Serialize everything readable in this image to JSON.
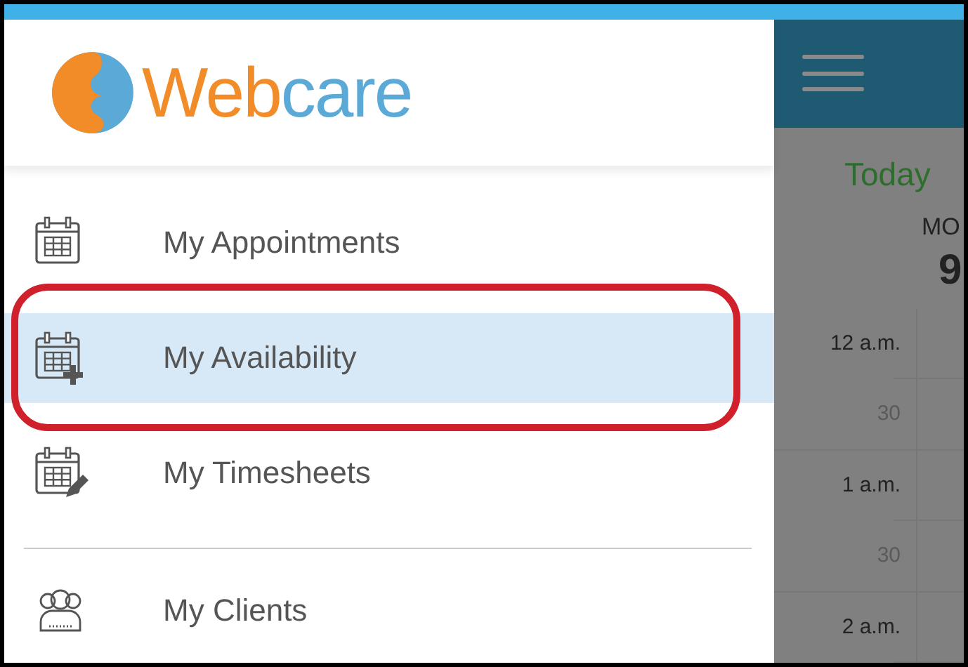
{
  "logo": {
    "text_primary": "Web",
    "text_secondary": "care"
  },
  "menu": [
    {
      "label": "My Appointments",
      "kind": "calendar",
      "selected": false,
      "callout": false,
      "divider_after": false
    },
    {
      "label": "My Availability",
      "kind": "calendar-plus",
      "selected": true,
      "callout": true,
      "divider_after": false
    },
    {
      "label": "My Timesheets",
      "kind": "calendar-pencil",
      "selected": false,
      "callout": false,
      "divider_after": true
    },
    {
      "label": "My Clients",
      "kind": "people",
      "selected": false,
      "callout": false,
      "divider_after": false
    }
  ],
  "calendar": {
    "today_button": "Today",
    "day_name": "MO",
    "day_number": "9",
    "times": [
      {
        "label": "12 a.m.",
        "kind": "hour"
      },
      {
        "label": "30",
        "kind": "half"
      },
      {
        "label": "1 a.m.",
        "kind": "hour"
      },
      {
        "label": "30",
        "kind": "half"
      },
      {
        "label": "2 a.m.",
        "kind": "hour"
      }
    ]
  }
}
